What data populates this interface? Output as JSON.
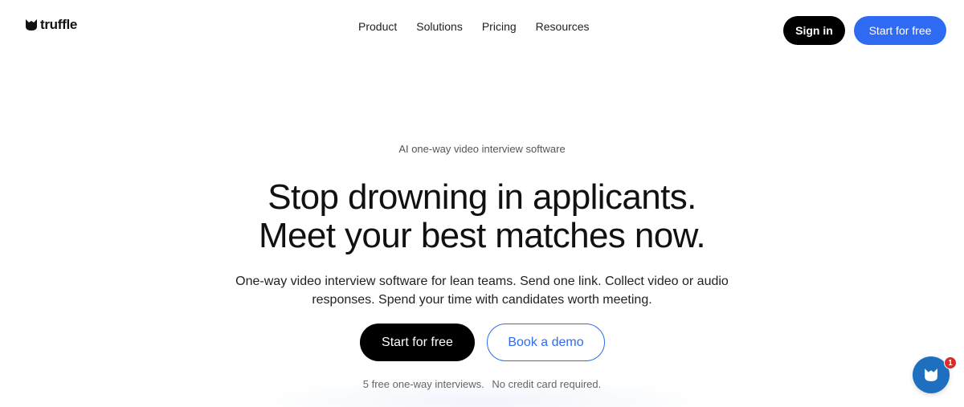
{
  "header": {
    "logo_text": "truffle",
    "nav": [
      {
        "label": "Product"
      },
      {
        "label": "Solutions"
      },
      {
        "label": "Pricing"
      },
      {
        "label": "Resources"
      }
    ],
    "sign_in_label": "Sign in",
    "start_label": "Start for free"
  },
  "hero": {
    "eyebrow": "AI one-way video interview software",
    "headline_line1": "Stop drowning in applicants.",
    "headline_line2": "Meet your best matches now.",
    "subtext": "One-way video interview software for lean teams. Send one link. Collect video or audio responses. Spend your time with candidates worth meeting.",
    "primary_cta": "Start for free",
    "secondary_cta": "Book a demo",
    "fine_print_1": "5 free one-way interviews.",
    "fine_print_2": "No credit card required."
  },
  "chat_widget": {
    "icon": "truffle-logo-icon",
    "badge_count": "1"
  },
  "colors": {
    "brand_blue": "#2f6bf2",
    "chat_blue": "#1e6fc0",
    "badge_red": "#d92d2d",
    "text_dark": "#111111"
  }
}
